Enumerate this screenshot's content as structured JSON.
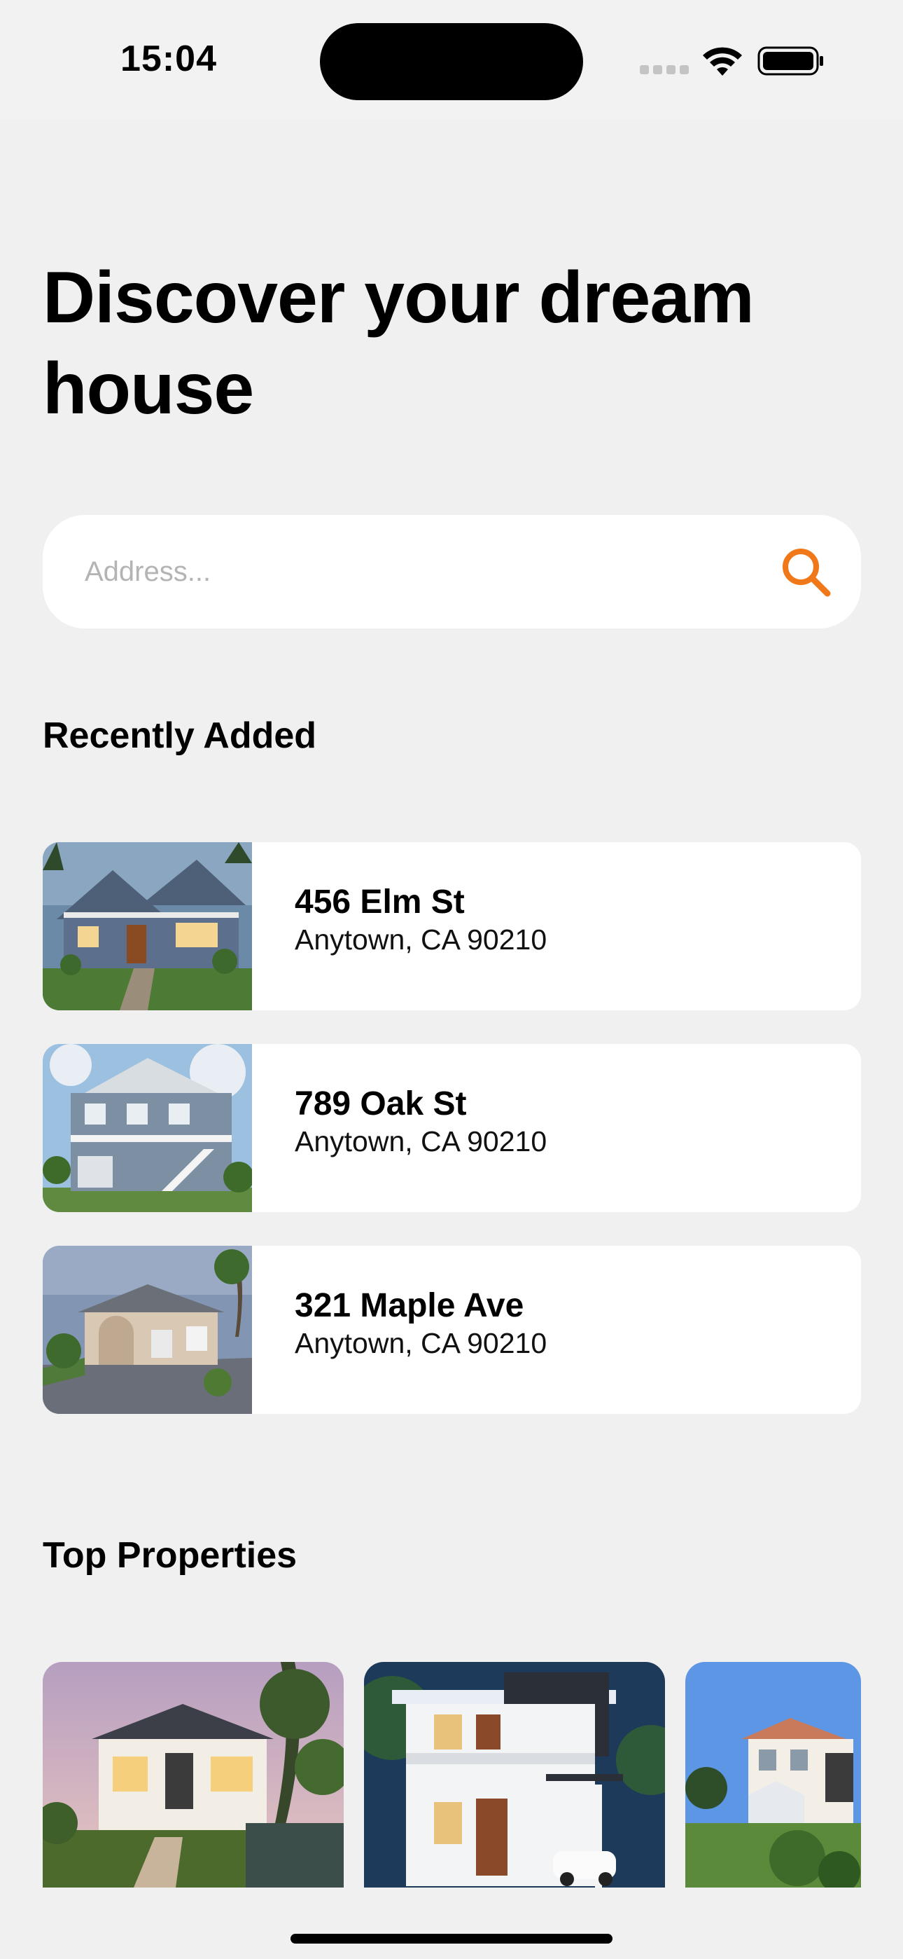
{
  "status_bar": {
    "time": "15:04"
  },
  "header": {
    "title": "Discover your dream house"
  },
  "search": {
    "placeholder": "Address...",
    "value": "",
    "icon": "search-icon",
    "accent_color": "#f07818"
  },
  "recently_added": {
    "title": "Recently Added",
    "items": [
      {
        "street": "456 Elm St",
        "city": "Anytown, CA 90210"
      },
      {
        "street": "789 Oak St",
        "city": "Anytown, CA 90210"
      },
      {
        "street": "321 Maple Ave",
        "city": "Anytown, CA 90210"
      }
    ]
  },
  "top_properties": {
    "title": "Top Properties"
  }
}
